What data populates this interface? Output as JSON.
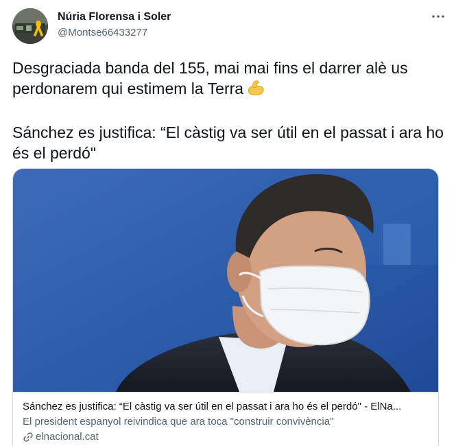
{
  "author": {
    "name": "Núria Florensa i Soler",
    "handle": "@Montse66433277"
  },
  "tweet": {
    "paragraph_1": "Desgraciada banda del 155, mai mai fins el darrer alè us perdonarem qui estimem la Terra",
    "emoji": "flexed-biceps-emoji",
    "paragraph_2": "Sánchez es justifica: “El càstig va ser útil en el passat i ara ho és el perdó\""
  },
  "card": {
    "title": "Sánchez es justifica: “El càstig va ser útil en el passat i ara ho és el perdó\" - ElNa...",
    "description": "El president espanyol reivindica que ara toca \"construir convivència\"",
    "domain": "elnacional.cat"
  },
  "icons": {
    "more": "more-icon",
    "link": "link-icon",
    "ribbon": "yellow-ribbon-icon"
  },
  "colors": {
    "text_primary": "#0f1419",
    "text_secondary": "#536471",
    "border": "#cfd9de",
    "image_background": "#2a5aa8",
    "ribbon": "#f2c200"
  }
}
